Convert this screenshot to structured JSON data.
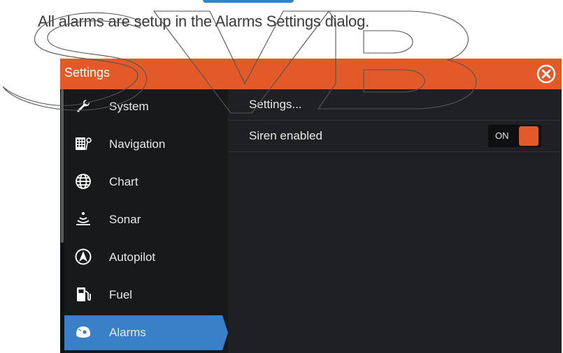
{
  "intro_text": "All alarms are setup in the Alarms Settings dialog.",
  "dialog": {
    "title": "Settings",
    "accent_color": "#e15a28",
    "active_color": "#3a80c8",
    "close_icon": "close-circle-icon"
  },
  "sidebar": {
    "items": [
      {
        "label": "System",
        "icon": "wrench-icon"
      },
      {
        "label": "Navigation",
        "icon": "navigation-icon"
      },
      {
        "label": "Chart",
        "icon": "globe-icon"
      },
      {
        "label": "Sonar",
        "icon": "sonar-icon"
      },
      {
        "label": "Autopilot",
        "icon": "autopilot-icon"
      },
      {
        "label": "Fuel",
        "icon": "fuel-pump-icon"
      },
      {
        "label": "Alarms",
        "icon": "alarm-icon",
        "active": true
      }
    ]
  },
  "content": {
    "rows": [
      {
        "label": "Settings..."
      },
      {
        "label": "Siren enabled",
        "toggle": "ON"
      }
    ]
  }
}
